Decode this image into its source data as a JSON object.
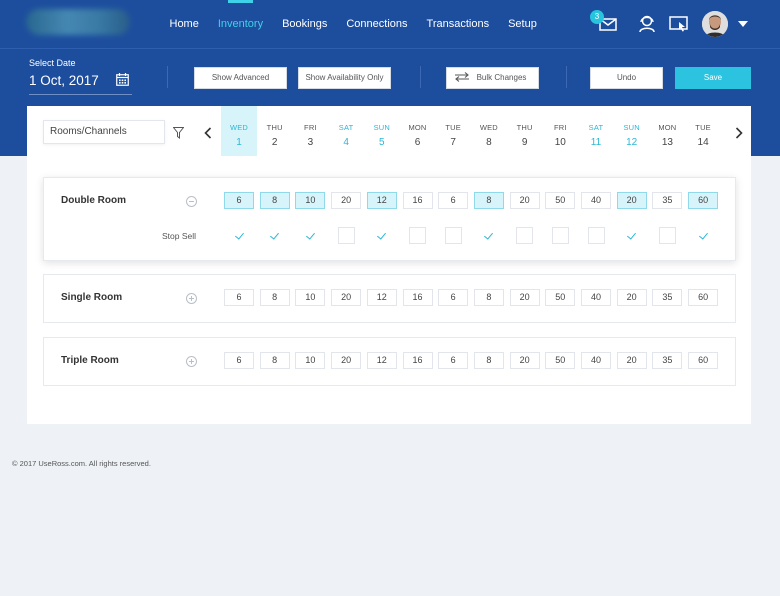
{
  "nav": {
    "items": [
      "Home",
      "Inventory",
      "Bookings",
      "Connections",
      "Transactions",
      "Setup"
    ],
    "active_index": 1
  },
  "header": {
    "mail_badge": "3",
    "icons": [
      "mail-icon",
      "support-agent-icon",
      "screen-cursor-icon",
      "avatar",
      "chevron-down-icon"
    ]
  },
  "toolbar": {
    "select_date_label": "Select Date",
    "date_value": "1 Oct, 2017",
    "show_advanced": "Show Advanced",
    "show_availability_only": "Show Availability Only",
    "bulk_changes": "Bulk Changes",
    "undo": "Undo",
    "save": "Save"
  },
  "grid": {
    "filter_label": "Rooms/Channels",
    "days": [
      {
        "name": "WED",
        "date": "1",
        "selected": true,
        "weekend": false
      },
      {
        "name": "THU",
        "date": "2",
        "weekend": false
      },
      {
        "name": "FRI",
        "date": "3",
        "weekend": false
      },
      {
        "name": "SAT",
        "date": "4",
        "weekend": true
      },
      {
        "name": "SUN",
        "date": "5",
        "weekend": true
      },
      {
        "name": "MON",
        "date": "6",
        "weekend": false
      },
      {
        "name": "TUE",
        "date": "7",
        "weekend": false
      },
      {
        "name": "WED",
        "date": "8",
        "weekend": false
      },
      {
        "name": "THU",
        "date": "9",
        "weekend": false
      },
      {
        "name": "FRI",
        "date": "10",
        "weekend": false
      },
      {
        "name": "SAT",
        "date": "11",
        "weekend": true
      },
      {
        "name": "SUN",
        "date": "12",
        "weekend": true
      },
      {
        "name": "MON",
        "date": "13",
        "weekend": false
      },
      {
        "name": "TUE",
        "date": "14",
        "weekend": false
      }
    ]
  },
  "rooms": [
    {
      "name": "Double Room",
      "expanded": true,
      "values": [
        "6",
        "8",
        "10",
        "20",
        "12",
        "16",
        "6",
        "8",
        "20",
        "50",
        "40",
        "20",
        "35",
        "60"
      ],
      "highlighted": [
        true,
        true,
        true,
        false,
        true,
        false,
        false,
        true,
        false,
        false,
        false,
        true,
        false,
        true
      ],
      "stop_sell_label": "Stop Sell",
      "stop_sell": [
        true,
        true,
        true,
        false,
        true,
        false,
        false,
        true,
        false,
        false,
        false,
        true,
        false,
        true
      ]
    },
    {
      "name": "Single Room",
      "expanded": false,
      "values": [
        "6",
        "8",
        "10",
        "20",
        "12",
        "16",
        "6",
        "8",
        "20",
        "50",
        "40",
        "20",
        "35",
        "60"
      ]
    },
    {
      "name": "Triple Room",
      "expanded": false,
      "values": [
        "6",
        "8",
        "10",
        "20",
        "12",
        "16",
        "6",
        "8",
        "20",
        "50",
        "40",
        "20",
        "35",
        "60"
      ]
    }
  ],
  "footer": {
    "copyright": "© 2017 UseRoss.com. All rights reserved."
  },
  "colors": {
    "primary": "#1d4e9e",
    "accent": "#2bc3df",
    "highlight": "#d7f4fa"
  }
}
